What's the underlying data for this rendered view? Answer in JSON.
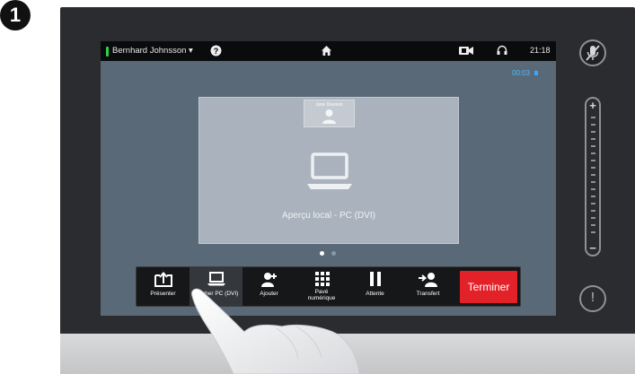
{
  "step": {
    "number": "1"
  },
  "status_bar": {
    "user_name": "Bernhard Johnsson",
    "clock": "21:18",
    "presence_color": "#2fd04a"
  },
  "call": {
    "timer": "00:03"
  },
  "preview": {
    "remote_participant": "Jane Dawson",
    "label": "Aperçu local - PC (DVI)"
  },
  "pager": {
    "count": 2,
    "active_index": 0
  },
  "toolbar": {
    "items": [
      {
        "label": "Présenter",
        "icon": "present-icon"
      },
      {
        "label": "Afficher PC (DVI)",
        "icon": "laptop-icon",
        "active": true
      },
      {
        "label": "Ajouter",
        "icon": "add-participant-icon"
      },
      {
        "label": "Pavé numérique",
        "icon": "keypad-icon"
      },
      {
        "label": "Attente",
        "icon": "pause-icon"
      },
      {
        "label": "Transfert",
        "icon": "transfer-icon"
      }
    ],
    "end_call_label": "Terminer",
    "end_call_color": "#e32129"
  },
  "side_controls": {
    "mute_icon": "mic-mute-icon",
    "volume_plus": "+",
    "volume_minus": "−",
    "alert_icon": "!"
  }
}
